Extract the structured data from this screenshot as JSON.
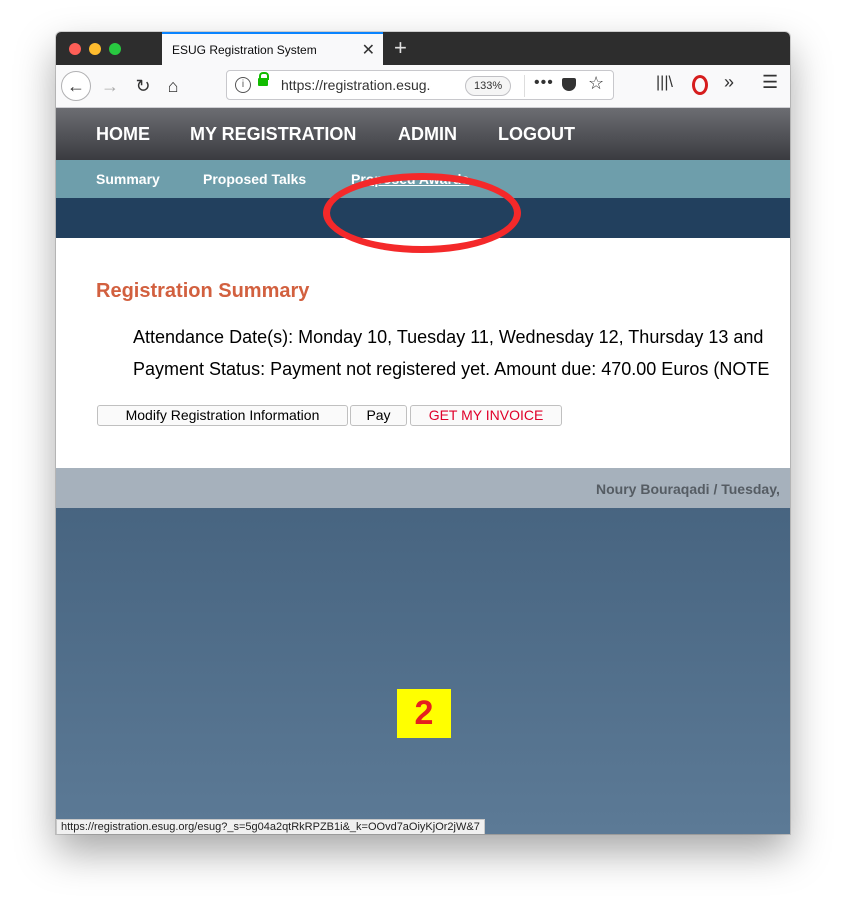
{
  "browser": {
    "tab_title": "ESUG Registration System",
    "new_tab": "+",
    "url": "https://registration.esug.org",
    "zoom": "133%"
  },
  "nav": {
    "main": [
      "HOME",
      "MY REGISTRATION",
      "ADMIN",
      "LOGOUT"
    ],
    "sub": [
      "Summary",
      "Proposed Talks",
      "Proposed Awards"
    ]
  },
  "content": {
    "heading": "Registration Summary",
    "attendance": "Attendance Date(s): Monday 10, Tuesday 11, Wednesday 12, Thursday 13 and",
    "payment": "Payment Status: Payment not registered yet. Amount due: 470.00 Euros (NOTE",
    "buttons": {
      "modify": "Modify Registration Information",
      "pay": "Pay",
      "invoice": "GET MY INVOICE"
    }
  },
  "footer": "Noury Bouraqadi / Tuesday,",
  "annotation": {
    "step": "2",
    "ring_color": "#f4292a"
  },
  "status_url": "https://registration.esug.org/esug?_s=5g04a2qtRkRPZB1i&_k=OOvd7aOiyKjOr2jW&7",
  "colors": {
    "heading": "#d2603f",
    "invoice": "#e0002a",
    "tab_accent": "#0a84ff"
  }
}
